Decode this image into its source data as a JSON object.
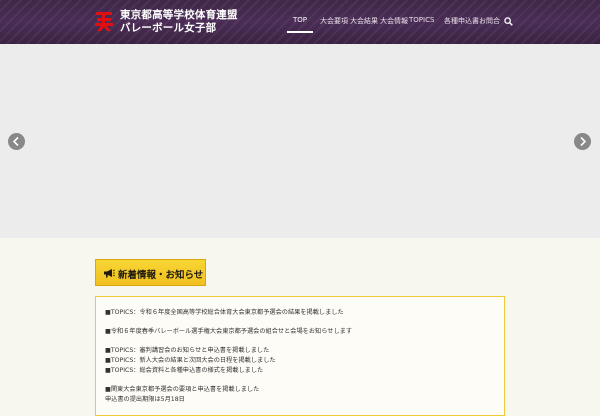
{
  "header": {
    "logo_line1": "東京都高等学校体育連盟",
    "logo_line2": "バレーボール女子部"
  },
  "nav": {
    "items": [
      {
        "label": "TOP",
        "active": true
      },
      {
        "label": "大会要項",
        "active": false
      },
      {
        "label": "大会結果",
        "active": false
      },
      {
        "label": "大会情報",
        "active": false
      },
      {
        "label": "TOPICS",
        "active": false
      },
      {
        "label": "各種申込書",
        "active": false
      },
      {
        "label": "お問合",
        "active": false
      }
    ],
    "search_icon": "search-icon"
  },
  "slider": {
    "prev_icon": "chevron-left-icon",
    "next_icon": "chevron-right-icon"
  },
  "section": {
    "heading": "新着情報・お知らせ"
  },
  "notices": [
    "■TOPICS：令和６年度全国高等学校総合体育大会東京都予選会の結果を掲載しました",
    "■令和６年度春季バレーボール選手権大会東京都予選会の組合せと会場をお知らせします",
    "■TOPICS：審判講習会のお知らせと申込書を掲載しました",
    "■TOPICS：新人大会の結果と次回大会の日程を掲載しました",
    "■TOPICS：総会資料と各種申込書の様式を掲載しました",
    "■関東大会東京都予選会の要項と申込書を掲載しました",
    "申込書の提出期限は5月18日"
  ],
  "colors": {
    "header_bg": "#4a2c55",
    "heading_bg": "#f5cd2a",
    "notice_border": "#f0c93a",
    "logo_red": "#e01010"
  }
}
